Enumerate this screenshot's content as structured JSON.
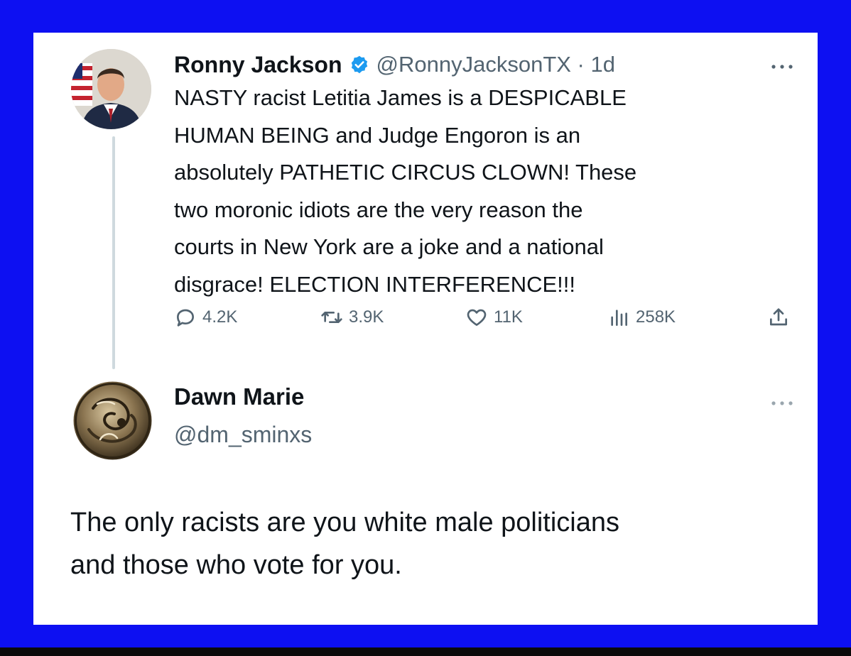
{
  "colors": {
    "frame": "#0d10f2",
    "card": "#ffffff",
    "verified": "#1d9bf0",
    "secondary_text": "#536471",
    "primary_text": "#0f1419"
  },
  "original_tweet": {
    "author_name": "Ronny Jackson",
    "verified_icon": "verified-badge-icon",
    "handle_time": "@RonnyJacksonTX · 1d",
    "more_icon": "more-options-icon",
    "text": "NASTY racist Letitia James is a DESPICABLE\nHUMAN BEING and Judge Engoron is an\nabsolutely PATHETIC CIRCUS CLOWN!  These\ntwo moronic idiots are the very reason the\ncourts in New York are a joke and a national\ndisgrace! ELECTION INTERFERENCE!!!",
    "actions": {
      "replies": "4.2K",
      "retweets": "3.9K",
      "likes": "11K",
      "views": "258K"
    }
  },
  "reply_tweet": {
    "author_name": "Dawn Marie",
    "handle": "@dm_sminxs",
    "more_icon": "more-options-icon",
    "text": "The only racists are you white male politicians\nand those who vote for you."
  }
}
